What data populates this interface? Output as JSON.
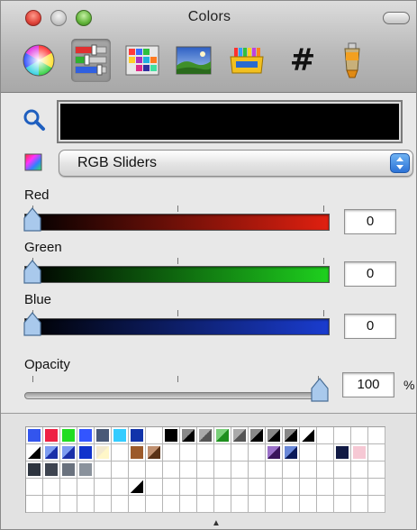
{
  "window": {
    "title": "Colors"
  },
  "toolbar": {
    "items": [
      {
        "icon": "color-wheel-icon"
      },
      {
        "icon": "color-sliders-icon"
      },
      {
        "icon": "color-palettes-icon"
      },
      {
        "icon": "image-palettes-icon"
      },
      {
        "icon": "crayons-icon"
      },
      {
        "icon": "hex-icon",
        "glyph": "#"
      },
      {
        "icon": "paint-tube-icon"
      }
    ],
    "selected_index": 1
  },
  "color_swatch": {
    "hex": "#000000"
  },
  "mode_popup": {
    "label": "RGB Sliders"
  },
  "sliders": [
    {
      "label": "Red",
      "value": "0",
      "gradient": [
        "#000000",
        "#ff0000"
      ]
    },
    {
      "label": "Green",
      "value": "0",
      "gradient": [
        "#000000",
        "#00ff00"
      ]
    },
    {
      "label": "Blue",
      "value": "0",
      "gradient": [
        "#000000",
        "#0000ff"
      ]
    }
  ],
  "opacity": {
    "label": "Opacity",
    "value": "100",
    "unit": "%",
    "level": 1.0
  },
  "palette": {
    "rows": [
      [
        "#3355ee",
        "#ee2244",
        "#22dd22",
        "#3355ff",
        "#4a5a78",
        "#33ccff",
        "#1133aa",
        "",
        "#000000",
        "dark-diag",
        "gray-diag",
        "green-diag",
        "gray-diag",
        "dark-diag",
        "dark-diag",
        "dark-diag",
        "mono-diag",
        "",
        "",
        "",
        ""
      ],
      [
        "mono-diag",
        "blue-diag",
        "blue-diag",
        "#1133cc",
        "cream-diag",
        "",
        "#9c5a2a",
        "brown-diag",
        "",
        "",
        "",
        "",
        "",
        "",
        "purple-diag",
        "navy-diag",
        "",
        "",
        "#111a44",
        "#f6c8d4",
        ""
      ],
      [
        "#2e3540",
        "#3e4450",
        "#6a727e",
        "#8a929c",
        "",
        "",
        "",
        "",
        "",
        "",
        "",
        "",
        "",
        "",
        "",
        "",
        "",
        "",
        "",
        "",
        ""
      ],
      [
        "",
        "",
        "",
        "",
        "",
        "",
        "corner-black",
        "",
        "",
        "",
        "",
        "",
        "",
        "",
        "",
        "",
        "",
        "",
        "",
        "",
        ""
      ],
      [
        "",
        "",
        "",
        "",
        "",
        "",
        "",
        "",
        "",
        "",
        "",
        "",
        "",
        "",
        "",
        "",
        "",
        "",
        "",
        "",
        ""
      ]
    ]
  }
}
